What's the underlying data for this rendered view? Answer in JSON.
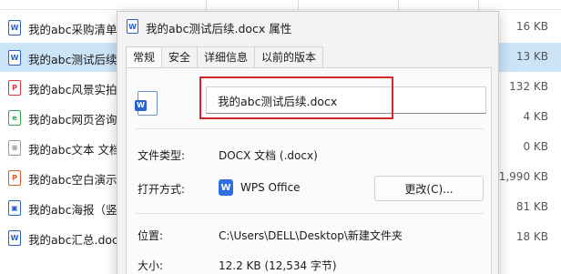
{
  "explorer": {
    "files": [
      {
        "name": "我的abc采购清单.",
        "size": "16 KB",
        "icon": "word-doc-icon",
        "glyph": "W",
        "kind": "word"
      },
      {
        "name": "我的abc测试后续.",
        "size": "13 KB",
        "icon": "word-doc-icon",
        "glyph": "W",
        "kind": "word",
        "selected": true
      },
      {
        "name": "我的abc风景实拍.",
        "size": "132 KB",
        "icon": "pdf-icon",
        "glyph": "P",
        "kind": "pdf"
      },
      {
        "name": "我的abc网页咨询.",
        "size": "4 KB",
        "icon": "web-page-icon",
        "glyph": "e",
        "kind": "web"
      },
      {
        "name": "我的abc文本 文档",
        "size": "0 KB",
        "icon": "text-file-icon",
        "glyph": "≡",
        "kind": "txt"
      },
      {
        "name": "我的abc空白演示",
        "size": "1,990 KB",
        "icon": "presentation-icon",
        "glyph": "P",
        "kind": "ppt"
      },
      {
        "name": "我的abc海报（竖版",
        "size": "81 KB",
        "icon": "image-file-icon",
        "glyph": "▣",
        "kind": "img"
      },
      {
        "name": "我的abc汇总.docx",
        "size": "18 KB",
        "icon": "word-doc-icon",
        "glyph": "W",
        "kind": "grid"
      }
    ]
  },
  "dialog": {
    "title": "我的abc测试后续.docx 属性",
    "tabs": [
      "常规",
      "安全",
      "详细信息",
      "以前的版本"
    ],
    "active_tab": "常规",
    "filename_value": "我的abc测试后续.docx",
    "file_type_label": "文件类型:",
    "file_type_value": "DOCX 文档 (.docx)",
    "open_with_label": "打开方式:",
    "open_with_app": "WPS Office",
    "change_button": "更改(C)...",
    "location_label": "位置:",
    "location_value": "C:\\Users\\DELL\\Desktop\\新建文件夹",
    "size_label": "大小:",
    "size_value": "12.2 KB (12,534 字节)",
    "highlight_color": "#d6262b",
    "accent_color": "#2b62c9"
  }
}
